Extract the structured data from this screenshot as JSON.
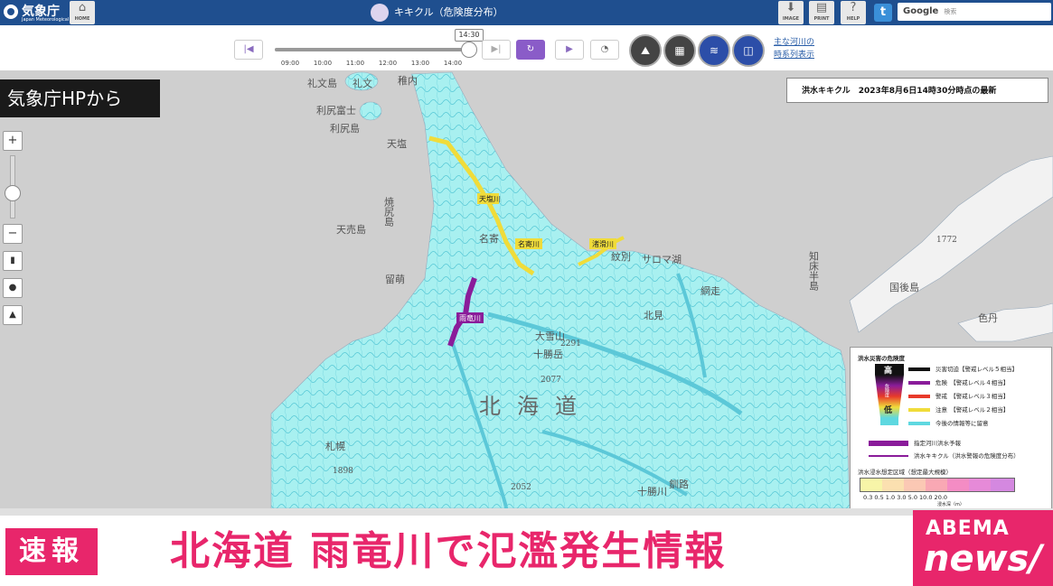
{
  "header": {
    "agency_name": "気象庁",
    "agency_name_en": "Japan Meteorological Agency",
    "home_label": "HOME",
    "map_title": "キキクル（危険度分布）",
    "image_label": "IMAGE",
    "print_label": "PRINT",
    "help_label": "HELP",
    "search_brand": "Google",
    "search_button": "検索"
  },
  "controls": {
    "current_time": "14:30",
    "timeline_ticks": [
      "09:00",
      "10:00",
      "11:00",
      "12:00",
      "13:00",
      "14:00"
    ],
    "timeline_progress": 0.95,
    "river_link": [
      "主な河川の",
      "時系列表示"
    ]
  },
  "overlay": {
    "source_caption": "気象庁HPから",
    "info_text": "洪水キキクル　2023年8月6日14時30分時点の最新"
  },
  "map_labels": {
    "island_rishiri": "利尻島",
    "island_rishiri_peak": "利尻富士",
    "island_rebun": "礼文島",
    "town_rebun": "礼文",
    "town_wakkanai": "稚内",
    "teshio": "天塩",
    "yagishiri": "焼尻島",
    "teuri": "天売島",
    "rumoi": "留萌",
    "monbetsu": "紋別",
    "kitami": "北見",
    "abashiri": "網走",
    "shiretoko": "知床半島",
    "kunashiri": "国後島",
    "etorofu": "色丹",
    "hokkaido": "北海道",
    "sapporo": "札幌",
    "kushiro": "釧路",
    "tokachi": "十勝川",
    "saroma": "サロマ湖",
    "nayoro": "名寄",
    "daisetsu": "大雪山",
    "tokachi_peak": "十勝岳",
    "river_uryu": "雨竜川",
    "river_teshio": "天塩川",
    "river_nayoro": "名寄川",
    "river_shibetsu": "渚滑川",
    "elev_2291": "2291",
    "elev_2077": "2077",
    "elev_1898": "1898",
    "elev_2052": "2052",
    "elev_1772": "1772"
  },
  "legend": {
    "title": "洪水災害の危険度",
    "high": "高",
    "low": "低",
    "danger_word": "危険度",
    "rows": [
      {
        "label": "災害切迫【警戒レベル５相当】",
        "color": "#111111"
      },
      {
        "label": "危険　【警戒レベル４相当】",
        "color": "#8a1c9a"
      },
      {
        "label": "警戒　【警戒レベル３相当】",
        "color": "#e83a2a"
      },
      {
        "label": "注意　【警戒レベル２相当】",
        "color": "#f0dc3a"
      },
      {
        "label": "今後の情報等に留意",
        "color": "#5ed8e0"
      }
    ],
    "forecast_river": "指定河川洪水予報",
    "kikikuru_flood": "洪水キキクル（洪水警報の危険度分布）",
    "depth_title": "洪水浸水想定区域（想定最大規模）",
    "depth_values": "0.3  0.5  1.0  3.0  5.0  10.0  20.0",
    "depth_unit": "浸水深（m）"
  },
  "banner": {
    "tag": "速報",
    "headline": "北海道 雨竜川で氾濫発生情報",
    "brand_top": "ABEMA",
    "brand_bottom": "news/"
  }
}
